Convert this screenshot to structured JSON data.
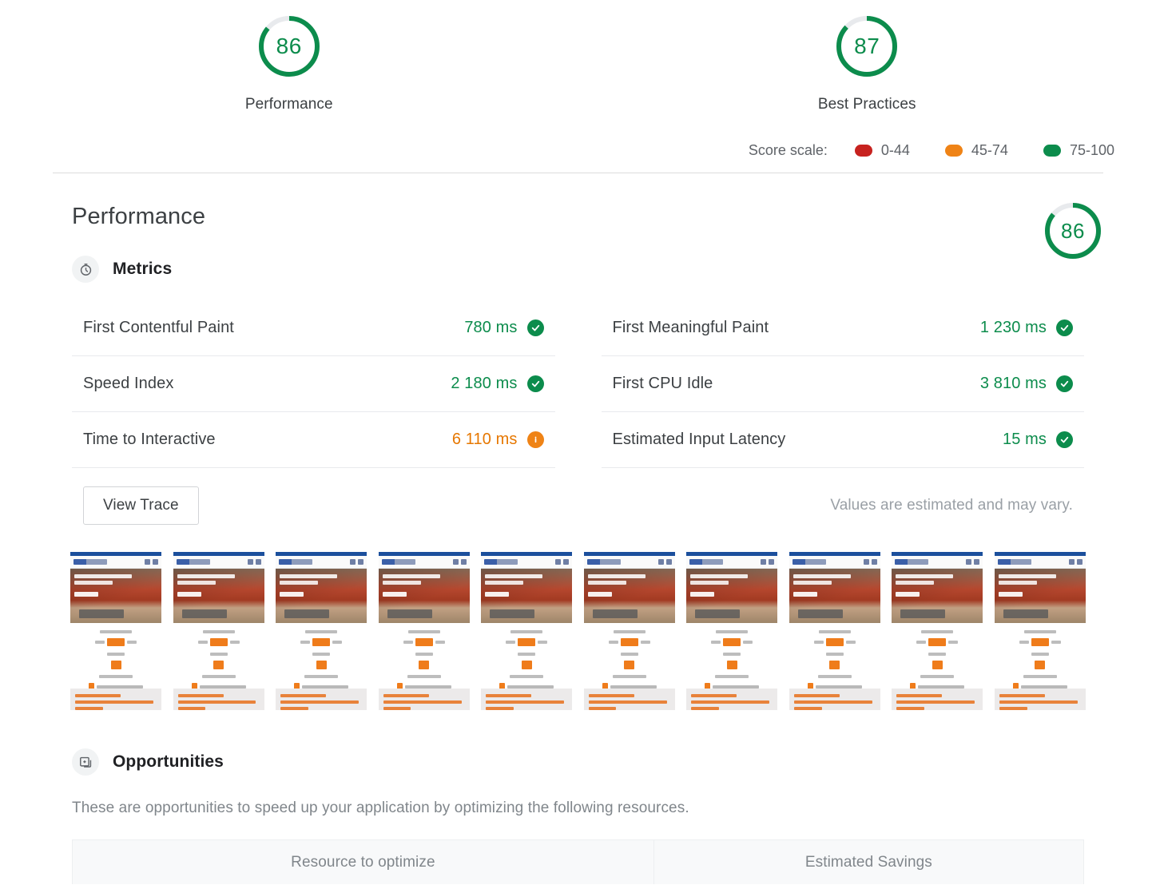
{
  "top_scores": [
    {
      "value": "86",
      "label": "Performance",
      "color": "#0c8c4c",
      "pct": 86
    },
    {
      "value": "87",
      "label": "Best Practices",
      "color": "#0c8c4c",
      "pct": 87
    }
  ],
  "score_scale": {
    "title": "Score scale:",
    "items": [
      {
        "range": "0-44",
        "color": "#c7221f"
      },
      {
        "range": "45-74",
        "color": "#ef8316"
      },
      {
        "range": "75-100",
        "color": "#0c8c4c"
      }
    ]
  },
  "performance_section": {
    "title": "Performance",
    "gauge": {
      "value": "86",
      "pct": 86,
      "color": "#0c8c4c"
    },
    "metrics_heading": "Metrics",
    "metrics_icon": "stopwatch-icon",
    "metrics_left": [
      {
        "name": "First Contentful Paint",
        "value": "780 ms",
        "status": "pass",
        "badge": "check-circle-icon"
      },
      {
        "name": "Speed Index",
        "value": "2 180 ms",
        "status": "pass",
        "badge": "check-circle-icon"
      },
      {
        "name": "Time to Interactive",
        "value": "6 110 ms",
        "status": "average",
        "badge": "info-circle-icon"
      }
    ],
    "metrics_right": [
      {
        "name": "First Meaningful Paint",
        "value": "1 230 ms",
        "status": "pass",
        "badge": "check-circle-icon"
      },
      {
        "name": "First CPU Idle",
        "value": "3 810 ms",
        "status": "pass",
        "badge": "check-circle-icon"
      },
      {
        "name": "Estimated Input Latency",
        "value": "15 ms",
        "status": "pass",
        "badge": "check-circle-icon"
      }
    ],
    "view_trace_label": "View Trace",
    "estimated_note": "Values are estimated and may vary."
  },
  "filmstrip": {
    "count": 10,
    "chat_badge_from_index": 4
  },
  "opportunities": {
    "heading": "Opportunities",
    "icon": "opportunity-card-icon",
    "description": "These are opportunities to speed up your application by optimizing the following resources.",
    "table": {
      "columns": [
        "Resource to optimize",
        "Estimated Savings"
      ]
    }
  }
}
